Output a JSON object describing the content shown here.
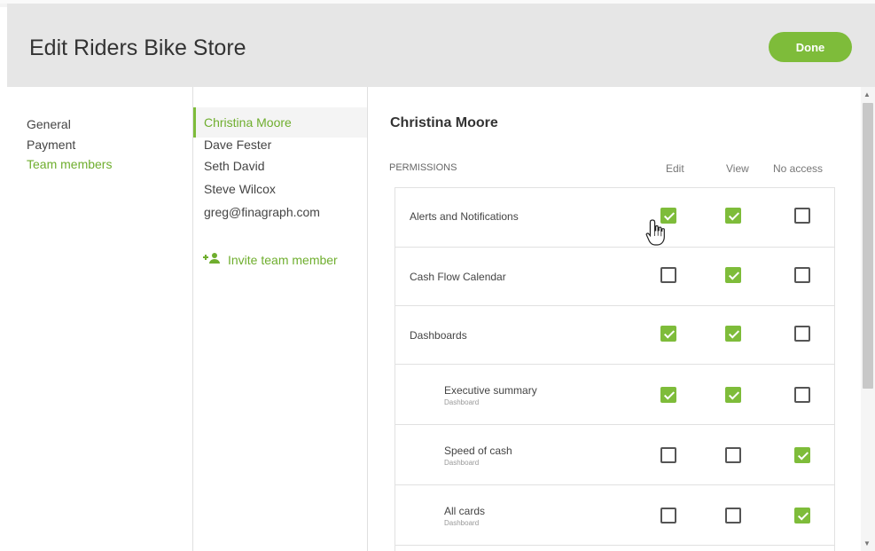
{
  "title": "Edit Riders Bike Store",
  "done_label": "Done",
  "nav": {
    "items": [
      {
        "label": "General",
        "active": false
      },
      {
        "label": "Payment",
        "active": false
      },
      {
        "label": "Team members",
        "active": true
      }
    ]
  },
  "members": {
    "items": [
      {
        "label": "Christina Moore",
        "active": true
      },
      {
        "label": "Dave Fester",
        "active": false
      },
      {
        "label": "Seth David",
        "active": false
      },
      {
        "label": "Steve Wilcox",
        "active": false
      },
      {
        "label": "greg@finagraph.com",
        "active": false
      }
    ],
    "invite_label": "Invite team member"
  },
  "main": {
    "person_name": "Christina Moore",
    "permissions_label": "PERMISSIONS",
    "columns": [
      "Edit",
      "View",
      "No access"
    ],
    "rows": [
      {
        "label": "Alerts and Notifications",
        "sub": "",
        "edit": true,
        "view": true,
        "none": false
      },
      {
        "label": "Cash Flow Calendar",
        "sub": "",
        "edit": false,
        "view": true,
        "none": false
      },
      {
        "label": "Dashboards",
        "sub": "",
        "edit": true,
        "view": true,
        "none": false
      },
      {
        "label": "Executive summary",
        "sub": "Dashboard",
        "edit": true,
        "view": true,
        "none": false
      },
      {
        "label": "Speed of cash",
        "sub": "Dashboard",
        "edit": false,
        "view": false,
        "none": true
      },
      {
        "label": "All cards",
        "sub": "Dashboard",
        "edit": false,
        "view": false,
        "none": true
      }
    ]
  },
  "colors": {
    "accent": "#7ebc3a",
    "header_bg": "#e6e6e6"
  }
}
